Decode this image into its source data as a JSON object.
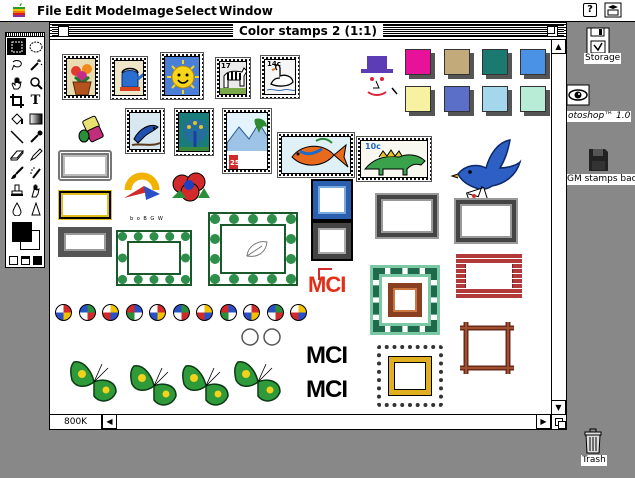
{
  "menubar": {
    "apple": "apple-menu",
    "items": [
      "File",
      "Edit",
      "Mode",
      "Image",
      "Select",
      "Window"
    ],
    "help": "?"
  },
  "window": {
    "title": "Color stamps 2  (1:1)",
    "size_field": "800K"
  },
  "canvas": {
    "mci_red": "MCI",
    "mci_black_1": "MCI",
    "mci_black_2": "MCI",
    "logo_caption": "b o B G W",
    "stamp_14c": "14c",
    "stamp_10c": "10c",
    "stamp_17": "17",
    "stamp_25": "25"
  },
  "desktop": {
    "storage_label": "Storage",
    "photoshop_label": "otoshop™ 1.0",
    "gm_label": "GM stamps backup",
    "trash_label": "Trash"
  },
  "toolbox": {
    "tools": [
      "marquee",
      "lasso",
      "hand",
      "magic-wand",
      "crop",
      "type",
      "bucket",
      "gradient",
      "line",
      "eyedropper",
      "eraser",
      "pencil",
      "brush",
      "airbrush",
      "stamp",
      "smudge",
      "blur",
      "sharpen"
    ]
  },
  "colors": {
    "foreground": "#000000",
    "background": "#ffffff",
    "desktop": "#888888"
  }
}
